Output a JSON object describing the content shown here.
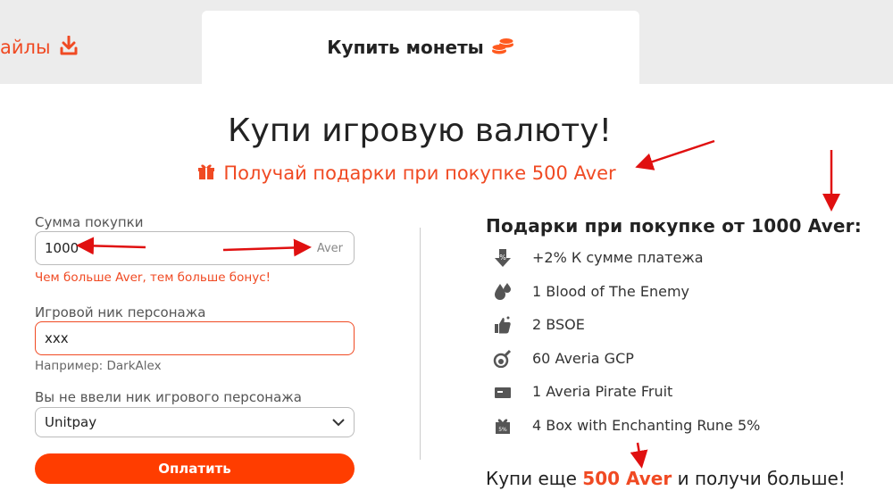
{
  "tabs": {
    "files_label": "айлы",
    "coins_label": "Купить монеты"
  },
  "page": {
    "title": "Купи игровую валюту!",
    "promo": "Получай подарки при покупке 500 Aver"
  },
  "form": {
    "amount_label": "Сумма покупки",
    "amount_value": "1000",
    "amount_unit": "Aver",
    "amount_hint": "Чем больше Aver, тем больше бонус!",
    "nick_label": "Игровой ник персонажа",
    "nick_value": "xxx",
    "nick_example": "Например: DarkAlex",
    "payment_label": "Вы не ввели ник игрового персонажа",
    "payment_selected": "Unitpay",
    "pay_button": "Оплатить"
  },
  "gifts": {
    "title": "Подарки при покупке от 1000 Aver:",
    "items": [
      {
        "icon": "percent-down-icon",
        "label": "+2% К сумме платежа"
      },
      {
        "icon": "blood-drops-icon",
        "label": "1 Blood of The Enemy"
      },
      {
        "icon": "thumbs-up-icon",
        "label": "2 BSOE"
      },
      {
        "icon": "potion-icon",
        "label": "60 Averia GCP"
      },
      {
        "icon": "ticket-icon",
        "label": "1 Averia Pirate Fruit"
      },
      {
        "icon": "gift-box-icon",
        "label": "4 Box with Enchanting Rune 5%"
      }
    ],
    "more_prefix": "Купи еще",
    "more_amount": "500 Aver",
    "more_suffix": "и получи больше!"
  },
  "colors": {
    "accent": "#f04a23",
    "button": "#ff3d00",
    "annotation": "#e01010"
  }
}
